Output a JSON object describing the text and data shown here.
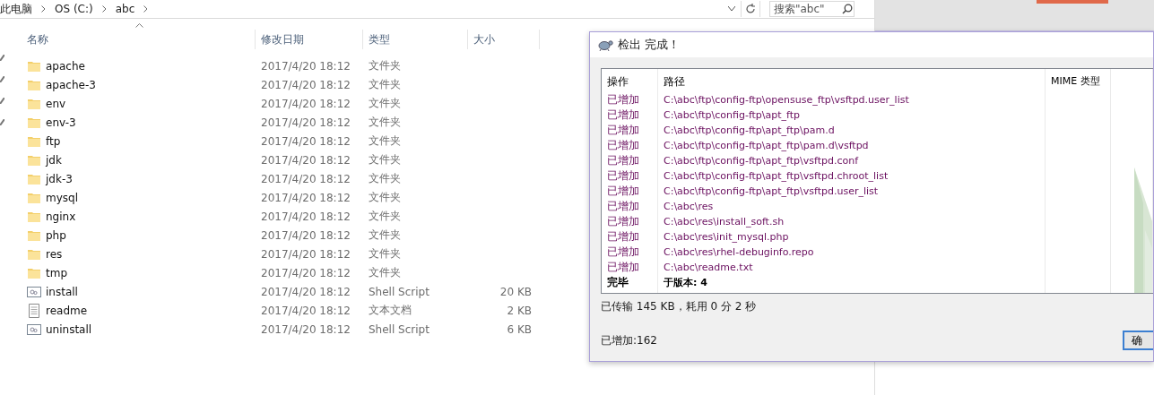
{
  "explorer": {
    "breadcrumb": [
      "此电脑",
      "OS (C:)",
      "abc"
    ],
    "search": {
      "placeholder": "搜索\"abc\""
    },
    "columns": [
      "名称",
      "修改日期",
      "类型",
      "大小"
    ],
    "rows": [
      {
        "name": "apache",
        "date": "2017/4/20 18:12",
        "type": "文件夹",
        "kind": "folder"
      },
      {
        "name": "apache-3",
        "date": "2017/4/20 18:12",
        "type": "文件夹",
        "kind": "folder"
      },
      {
        "name": "env",
        "date": "2017/4/20 18:12",
        "type": "文件夹",
        "kind": "folder"
      },
      {
        "name": "env-3",
        "date": "2017/4/20 18:12",
        "type": "文件夹",
        "kind": "folder"
      },
      {
        "name": "ftp",
        "date": "2017/4/20 18:12",
        "type": "文件夹",
        "kind": "folder"
      },
      {
        "name": "jdk",
        "date": "2017/4/20 18:12",
        "type": "文件夹",
        "kind": "folder"
      },
      {
        "name": "jdk-3",
        "date": "2017/4/20 18:12",
        "type": "文件夹",
        "kind": "folder"
      },
      {
        "name": "mysql",
        "date": "2017/4/20 18:12",
        "type": "文件夹",
        "kind": "folder"
      },
      {
        "name": "nginx",
        "date": "2017/4/20 18:12",
        "type": "文件夹",
        "kind": "folder"
      },
      {
        "name": "php",
        "date": "2017/4/20 18:12",
        "type": "文件夹",
        "kind": "folder"
      },
      {
        "name": "res",
        "date": "2017/4/20 18:12",
        "type": "文件夹",
        "kind": "folder"
      },
      {
        "name": "tmp",
        "date": "2017/4/20 18:12",
        "type": "文件夹",
        "kind": "folder"
      },
      {
        "name": "install",
        "date": "2017/4/20 18:12",
        "type": "Shell Script",
        "size": "20 KB",
        "kind": "script"
      },
      {
        "name": "readme",
        "date": "2017/4/20 18:12",
        "type": "文本文档",
        "size": "2 KB",
        "kind": "text"
      },
      {
        "name": "uninstall",
        "date": "2017/4/20 18:12",
        "type": "Shell Script",
        "size": "6 KB",
        "kind": "script"
      }
    ]
  },
  "dialog": {
    "title": "检出 完成！",
    "columns": [
      "操作",
      "路径",
      "MIME 类型"
    ],
    "rows": [
      {
        "action": "已增加",
        "path": "C:\\abc\\ftp\\config-ftp\\opensuse_ftp\\vsftpd.user_list",
        "kind": "added"
      },
      {
        "action": "已增加",
        "path": "C:\\abc\\ftp\\config-ftp\\apt_ftp",
        "kind": "added"
      },
      {
        "action": "已增加",
        "path": "C:\\abc\\ftp\\config-ftp\\apt_ftp\\pam.d",
        "kind": "added"
      },
      {
        "action": "已增加",
        "path": "C:\\abc\\ftp\\config-ftp\\apt_ftp\\pam.d\\vsftpd",
        "kind": "added"
      },
      {
        "action": "已增加",
        "path": "C:\\abc\\ftp\\config-ftp\\apt_ftp\\vsftpd.conf",
        "kind": "added"
      },
      {
        "action": "已增加",
        "path": "C:\\abc\\ftp\\config-ftp\\apt_ftp\\vsftpd.chroot_list",
        "kind": "added"
      },
      {
        "action": "已增加",
        "path": "C:\\abc\\ftp\\config-ftp\\apt_ftp\\vsftpd.user_list",
        "kind": "added"
      },
      {
        "action": "已增加",
        "path": "C:\\abc\\res",
        "kind": "added"
      },
      {
        "action": "已增加",
        "path": "C:\\abc\\res\\install_soft.sh",
        "kind": "added"
      },
      {
        "action": "已增加",
        "path": "C:\\abc\\res\\init_mysql.php",
        "kind": "added"
      },
      {
        "action": "已增加",
        "path": "C:\\abc\\res\\rhel-debuginfo.repo",
        "kind": "added"
      },
      {
        "action": "已增加",
        "path": "C:\\abc\\readme.txt",
        "kind": "added"
      },
      {
        "action": "完毕",
        "path": "于版本: 4",
        "kind": "done"
      }
    ],
    "transfer": "已传输 145 KB，耗用 0 分 2 秒",
    "summary": "已增加:162",
    "ok_button": "确"
  }
}
